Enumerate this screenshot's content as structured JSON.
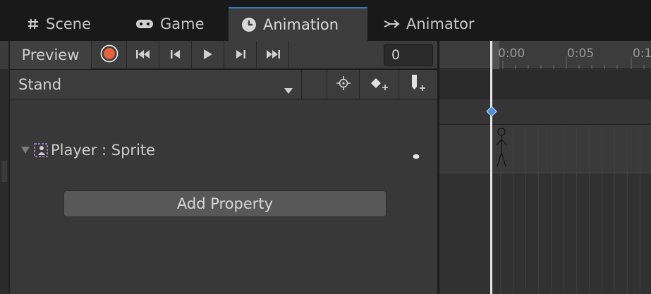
{
  "tabs": [
    {
      "label": "Scene",
      "icon": "hash-icon"
    },
    {
      "label": "Game",
      "icon": "gamepad-icon"
    },
    {
      "label": "Animation",
      "icon": "clock-icon",
      "active": true
    },
    {
      "label": "Animator",
      "icon": "animator-icon"
    }
  ],
  "toolbar": {
    "preview_label": "Preview",
    "frame_value": "0"
  },
  "clip": {
    "selected": "Stand"
  },
  "properties": {
    "object_label": "Player : Sprite",
    "add_property_label": "Add Property"
  },
  "timeline": {
    "ticks": [
      "0:00",
      "0:05",
      "0:1"
    ]
  },
  "colors": {
    "record": "#e8613a",
    "keyframe": "#4d8fe0",
    "active_tab_border": "#3a79bb",
    "playhead": "#e6e6e6"
  }
}
